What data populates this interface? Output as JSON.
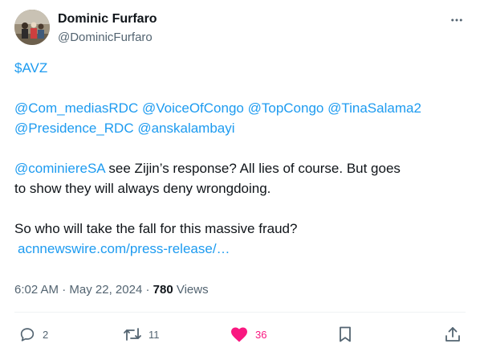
{
  "author": {
    "name": "Dominic Furfaro",
    "handle": "@DominicFurfaro"
  },
  "body": {
    "line1": "$AVZ",
    "mentions_line1": [
      "@Com_mediasRDC",
      "@VoiceOfCongo",
      "@TopCongo",
      "@TinaSalama2"
    ],
    "mentions_line2": [
      "@Presidence_RDC",
      "@anskalambayi"
    ],
    "reply_mention": "@cominiereSA",
    "para1_rest": " see Zijin’s response? All lies of course. But goes",
    "para1_line2": "to show they will always deny wrongdoing.",
    "para2_line1": "So who will take the fall for this massive fraud?",
    "url": "acnnewswire.com/press-release/…"
  },
  "meta": {
    "time": "6:02 AM",
    "separator": " · ",
    "date": "May 22, 2024",
    "views_count": "780",
    "views_label": " Views"
  },
  "actions": {
    "replies": "2",
    "retweets": "11",
    "likes": "36"
  },
  "icons": {
    "more": "more-horizontal-icon",
    "reply": "reply-icon",
    "retweet": "retweet-icon",
    "like": "heart-icon",
    "bookmark": "bookmark-icon",
    "share": "share-icon"
  },
  "colors": {
    "link": "#1d9bf0",
    "text": "#0f1419",
    "secondary": "#536471",
    "like": "#f91880"
  }
}
